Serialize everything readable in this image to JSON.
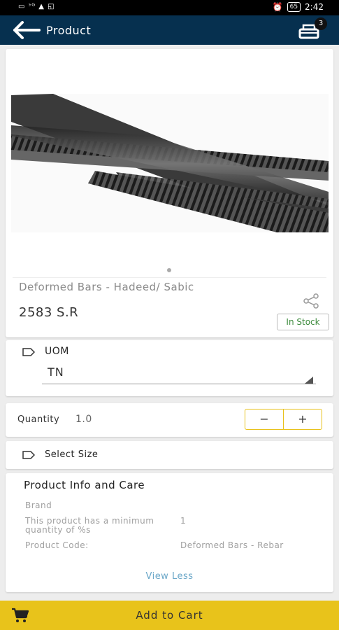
{
  "status_bar": {
    "left_icons": "▭ ᵌᴳ ▲ ◱",
    "battery": "65",
    "time": "2:42"
  },
  "app_bar": {
    "title": "Product",
    "cart_count": "3"
  },
  "product": {
    "name": "Deformed Bars - Hadeed/ Sabic",
    "price": "2583 S.R",
    "stock_status": "In Stock",
    "image_icon": "rebar-image"
  },
  "uom": {
    "label": "UOM",
    "selected": "TN"
  },
  "quantity": {
    "label": "Quantity",
    "value": "1.0",
    "minus_label": "−",
    "plus_label": "+"
  },
  "size": {
    "label": "Select Size"
  },
  "info": {
    "title": "Product Info and Care",
    "rows": [
      {
        "label": "Brand",
        "value": ""
      },
      {
        "label": "This product has a minimum quantity of %s",
        "value": "1"
      },
      {
        "label": "Product Code:",
        "value": "Deformed Bars - Rebar"
      }
    ],
    "toggle_label": "View Less"
  },
  "footer": {
    "add_to_cart_label": "Add to Cart"
  },
  "colors": {
    "app_bar": "#06304f",
    "accent_yellow": "#e8c31b",
    "stock_green": "#3b8a3b",
    "link_blue": "#6aa7c8"
  }
}
